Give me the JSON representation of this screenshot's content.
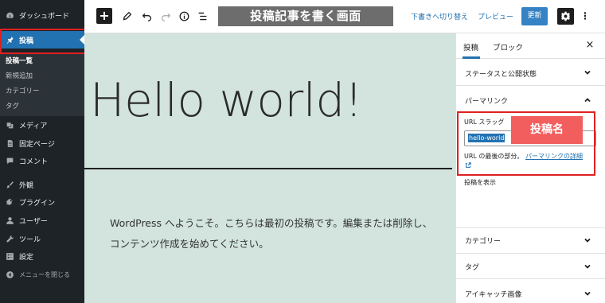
{
  "sidebar": {
    "dashboard": "ダッシュボード",
    "posts": "投稿",
    "posts_submenu": [
      "投稿一覧",
      "新規追加",
      "カテゴリー",
      "タグ"
    ],
    "media": "メディア",
    "pages": "固定ページ",
    "comments": "コメント",
    "appearance": "外観",
    "plugins": "プラグイン",
    "users": "ユーザー",
    "tools": "ツール",
    "settings": "設定",
    "collapse": "メニューを閉じる"
  },
  "toolbar": {
    "add_label": "+",
    "caption": "投稿記事を書く画面",
    "draft_label": "下書きへ切り替え",
    "preview_label": "プレビュー",
    "update_label": "更新",
    "more_label": "⋮"
  },
  "editor": {
    "title": "Hello world!",
    "body": "WordPress へようこそ。こちらは最初の投稿です。編集または削除し、コンテンツ作成を始めてください。"
  },
  "panel": {
    "tabs": [
      "投稿",
      "ブロック"
    ],
    "close_label": "×",
    "sections": {
      "status": "ステータスと公開状態",
      "permalink": "パーマリンク",
      "categories": "カテゴリー",
      "tags": "タグ",
      "featured_image": "アイキャッチ画像"
    },
    "slug_label": "URL スラッグ",
    "slug_value": "hello-world",
    "slug_help_prefix": "URL の最後の部分。",
    "slug_help_link": "パーマリンクの詳細",
    "view_post": "投稿を表示",
    "slug_badge": "投稿名"
  },
  "colors": {
    "admin_sidebar": "#1d2327",
    "admin_accent": "#2271b1",
    "canvas_bg": "#d2e4dd",
    "annotation_red": "#e02020",
    "badge_red": "#f25e5e",
    "caption_gray": "#6d6d6d"
  }
}
